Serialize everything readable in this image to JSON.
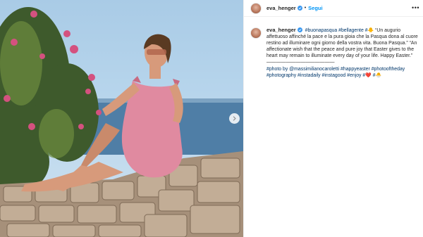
{
  "post": {
    "username": "eva_henger",
    "follow_label": "Segui",
    "more_label": "•••",
    "dot": "•",
    "caption": {
      "hash1": "#buonapasqua #bellagente",
      "hash2": "#",
      "emoji1": "🐥",
      "text_it": "“Un augurio affettuoso affinché la pace e la pura gioia che la Pasqua dona al cuore restino ad illuminare ogni giorno della vostra vita. Buona Pasqua.” “An affectionate wish that the peace and pure joy that Easter gives to the heart may remain to illuminate every day of your life. Happy Easter.” ——————————————",
      "tags_line1": "#photo by @massimilianocaroletti #happyeaster #photooftheday",
      "tags_line2": "#photography #instadaily #instagood #enjoy #",
      "emoji2": "❤️",
      "tag_end": "#",
      "emoji3": "🐣"
    }
  },
  "icons": {
    "verified": "verified-badge-icon",
    "next": "chevron-right-icon"
  },
  "colors": {
    "accent": "#0095f6",
    "tag": "#00376b",
    "text": "#262626"
  }
}
